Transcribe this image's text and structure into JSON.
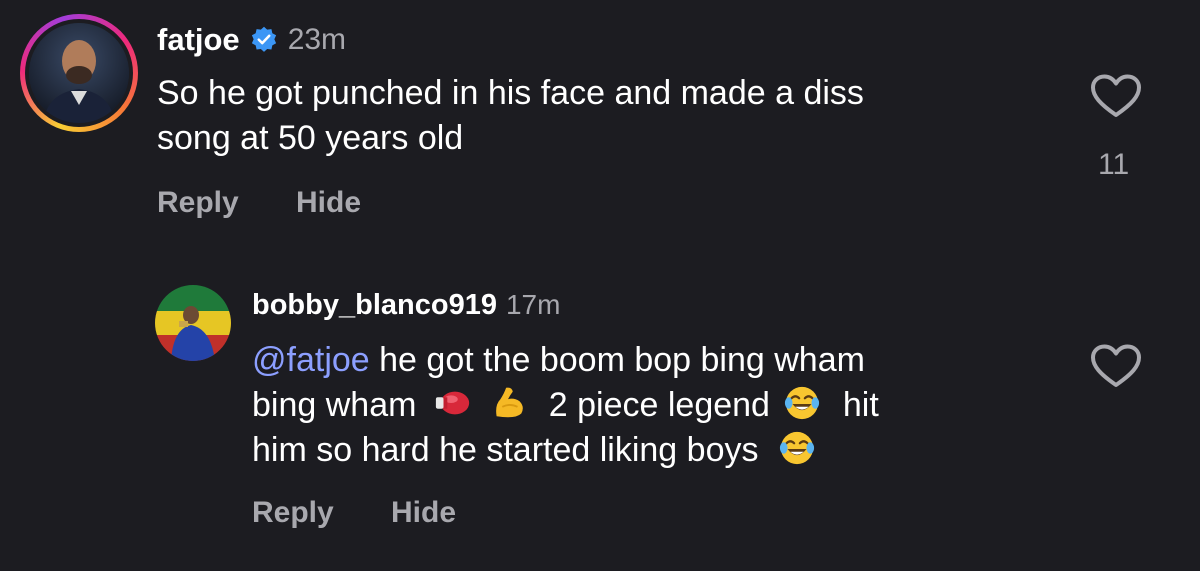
{
  "comment": {
    "username": "fatjoe",
    "verified": true,
    "time": "23m",
    "text_line1": "So he got punched in his face and made a diss",
    "text_line2": "song at 50 years old",
    "like_count": "11",
    "reply_label": "Reply",
    "hide_label": "Hide"
  },
  "reply": {
    "username": "bobby_blanco919",
    "time": "17m",
    "mention": "@fatjoe",
    "line1_rest": " he got the boom bop bing wham",
    "line2_a": "bing wham",
    "line2_b": "2 piece legend",
    "line2_c": "hit",
    "line3": "him so hard he started liking boys",
    "reply_label": "Reply",
    "hide_label": "Hide"
  },
  "icons": {
    "verified": "verified-badge-icon",
    "heart": "heart-outline-icon",
    "emoji_glove": "boxing-glove-emoji",
    "emoji_muscle": "flexed-biceps-emoji",
    "emoji_laugh": "tears-of-joy-emoji"
  },
  "colors": {
    "background": "#1c1c21",
    "text": "#ffffff",
    "secondary": "#a8a8ae",
    "mention": "#8c9fff",
    "verified": "#3b96f5"
  }
}
